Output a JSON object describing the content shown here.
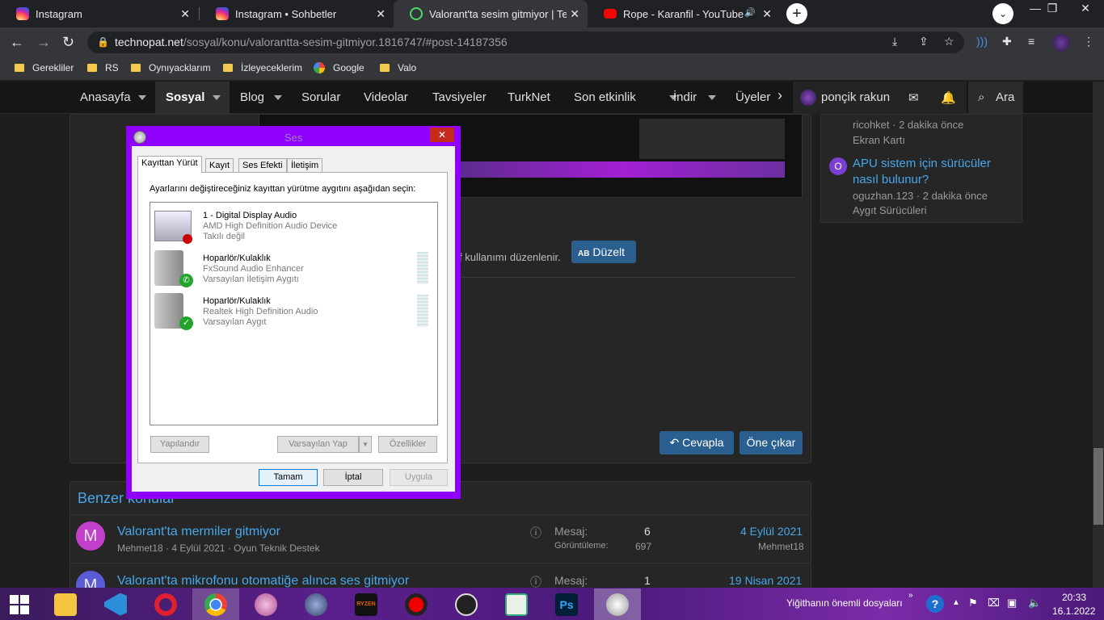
{
  "browser": {
    "tabs": [
      {
        "title": "Instagram",
        "close": "✕"
      },
      {
        "title": "Instagram • Sohbetler",
        "close": "✕"
      },
      {
        "title": "Valorant'ta sesim gitmiyor | Techn",
        "close": "✕"
      },
      {
        "title": "Rope - Karanfil - YouTube",
        "close": "✕",
        "audio": "🔊"
      }
    ],
    "newtab": "+",
    "url_host": "technopat.net",
    "url_path": "/sosyal/konu/valorantta-sesim-gitmiyor.1816747/#post-14187356",
    "bookmarks": [
      "Gerekliler",
      "RS",
      "Oynıyacklarım",
      "İzleyeceklerim",
      "Google",
      "Valo"
    ]
  },
  "site": {
    "nav": [
      "Anasayfa",
      "Sosyal",
      "Blog",
      "Sorular",
      "Videolar",
      "Tavsiyeler",
      "TurkNet",
      "Son etkinlik",
      "İndir",
      "Üyeler"
    ],
    "user": "ponçik rakun",
    "search": "Ara",
    "sidebar": [
      {
        "meta": "ricohket · 2 dakika önce",
        "cat": "Ekran Kartı"
      },
      {
        "title": "APU sistem için sürücüler nasıl bulunur?",
        "meta": "oguzhan.123 · 2 dakika önce",
        "cat": "Aygıt Sürücüleri",
        "avatar": "O"
      }
    ],
    "edit_note": "f kullanımı düzenlenir.",
    "edit_button": "Düzelt",
    "reply_button": "Cevapla",
    "feature_button": "Öne çıkar",
    "similar_heading": "Benzer konular",
    "threads": [
      {
        "avatar": "M",
        "title": "Valorant'ta mermiler gitmiyor",
        "author": "Mehmet18",
        "date": "4 Eylül 2021",
        "forum": "Oyun Teknik Destek",
        "replies_label": "Mesaj:",
        "replies": "6",
        "views_label": "Görüntüleme:",
        "views": "697",
        "last_date": "4 Eylül 2021",
        "last_user": "Mehmet18"
      },
      {
        "avatar": "M",
        "title": "Valorant'ta mikrofonu otomatiğe alınca ses gitmiyor",
        "replies_label": "Mesaj:",
        "replies": "1",
        "last_date": "19 Nisan 2021"
      }
    ]
  },
  "dialog": {
    "title": "Ses",
    "close": "✕",
    "tabs": [
      "Kayıttan Yürüt",
      "Kayıt",
      "Ses Efekti",
      "İletişim"
    ],
    "instruction": "Ayarlarını değiştireceğiniz kayıttan yürütme aygıtını aşağıdan seçin:",
    "devices": [
      {
        "name": "1 - Digital Display Audio",
        "driver": "AMD High Definition Audio Device",
        "status": "Takılı değil"
      },
      {
        "name": "Hoparlör/Kulaklık",
        "driver": "FxSound Audio Enhancer",
        "status": "Varsayılan İletişim Aygıtı"
      },
      {
        "name": "Hoparlör/Kulaklık",
        "driver": "Realtek High Definition Audio",
        "status": "Varsayılan Aygıt"
      }
    ],
    "configure": "Yapılandır",
    "set_default": "Varsayılan Yap",
    "properties": "Özellikler",
    "ok": "Tamam",
    "cancel": "İptal",
    "apply": "Uygula"
  },
  "taskbar": {
    "notify_text": "Yiğithanın önemli dosyaları",
    "time": "20:33",
    "date": "16.1.2022"
  },
  "colors": {
    "dialog_border": "#8f00ff",
    "link": "#47a7eb",
    "button": "#2b5f8f"
  }
}
